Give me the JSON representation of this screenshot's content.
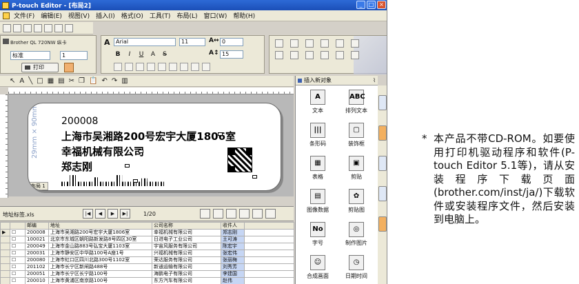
{
  "window": {
    "title": "P-touch Editor - [布局2]"
  },
  "menu": [
    "文件(F)",
    "编辑(E)",
    "视图(V)",
    "插入(I)",
    "格式(O)",
    "工具(T)",
    "布局(L)",
    "窗口(W)",
    "帮助(H)"
  ],
  "printer": {
    "name": "Brother QL 720NW 纵卡",
    "mode": "标准",
    "print_label": "打印"
  },
  "font": {
    "family": "Arial",
    "size": "11",
    "spacing": "0",
    "line_spacing": "15"
  },
  "style_buttons": [
    "B",
    "I",
    "U",
    "A",
    "S"
  ],
  "label": {
    "dimension": "29mm × 90mm",
    "lines": [
      "200008",
      "上海市吴湘路200号宏宇大厦1806室",
      "幸福机械有限公司",
      "郑志刚"
    ],
    "tab": "布局 1"
  },
  "database": {
    "file": "地址标签.xls",
    "page": "1/20",
    "columns": [
      "邮编",
      "地址",
      "公司名称",
      "收件人"
    ],
    "rows": [
      [
        "200008",
        "上海市吴湘路200号宏宇大厦1806室",
        "幸福机械有限公司",
        "郑志刚"
      ],
      [
        "100021",
        "北京市东城区朝阳路新发路8号四区30室",
        "日进电子工业公司",
        "王可涛"
      ],
      [
        "200049",
        "上海市金山路883号弘宝大厦1103室",
        "宇宙风服务有限公司",
        "陈宏宇"
      ],
      [
        "200031",
        "上海市静安区中华路100号A座1号",
        "兴福机械有限公司",
        "张宏伟"
      ],
      [
        "200080",
        "上海市虹口区四川北路300号1102室",
        "荣达服务有限公司",
        "张丽梅"
      ],
      [
        "201102",
        "上海市长宁区新闸路488号",
        "新通运输有限公司",
        "刘秀芳"
      ],
      [
        "200051",
        "上海市长宁区长宁路100号",
        "海鹏电子有限公司",
        "李建国"
      ],
      [
        "200010",
        "上海市黄浦区南京路100号",
        "东方汽车有限公司",
        "赵伟"
      ]
    ]
  },
  "object_panel": {
    "title": "插入新对象",
    "items": [
      {
        "label": "文本",
        "glyph": "A"
      },
      {
        "label": "排列文本",
        "glyph": "ABC"
      },
      {
        "label": "条形码",
        "glyph": "|||"
      },
      {
        "label": "装饰框",
        "glyph": "▢"
      },
      {
        "label": "表格",
        "glyph": "▦"
      },
      {
        "label": "剪贴",
        "glyph": "▣"
      },
      {
        "label": "图像数据",
        "glyph": "▤"
      },
      {
        "label": "剪贴图",
        "glyph": "✿"
      },
      {
        "label": "字号",
        "glyph": "No"
      },
      {
        "label": "制作图片",
        "glyph": "◎"
      },
      {
        "label": "合成画面",
        "glyph": "☺"
      },
      {
        "label": "日期时间",
        "glyph": "◷"
      }
    ]
  },
  "note": {
    "mark": "*",
    "text": "本产品不带CD-ROM。如要使用打印机驱动程序和软件(P-touch Editor 5.1等)，请从安装程序下载页面(brother.com/inst/ja/)下载软件或安装程序文件，然后安装到电脑上。"
  },
  "colors": {
    "title_bar": "#1b4fb8",
    "selection": "#c6d6f4",
    "chrome": "#ece9d8"
  }
}
